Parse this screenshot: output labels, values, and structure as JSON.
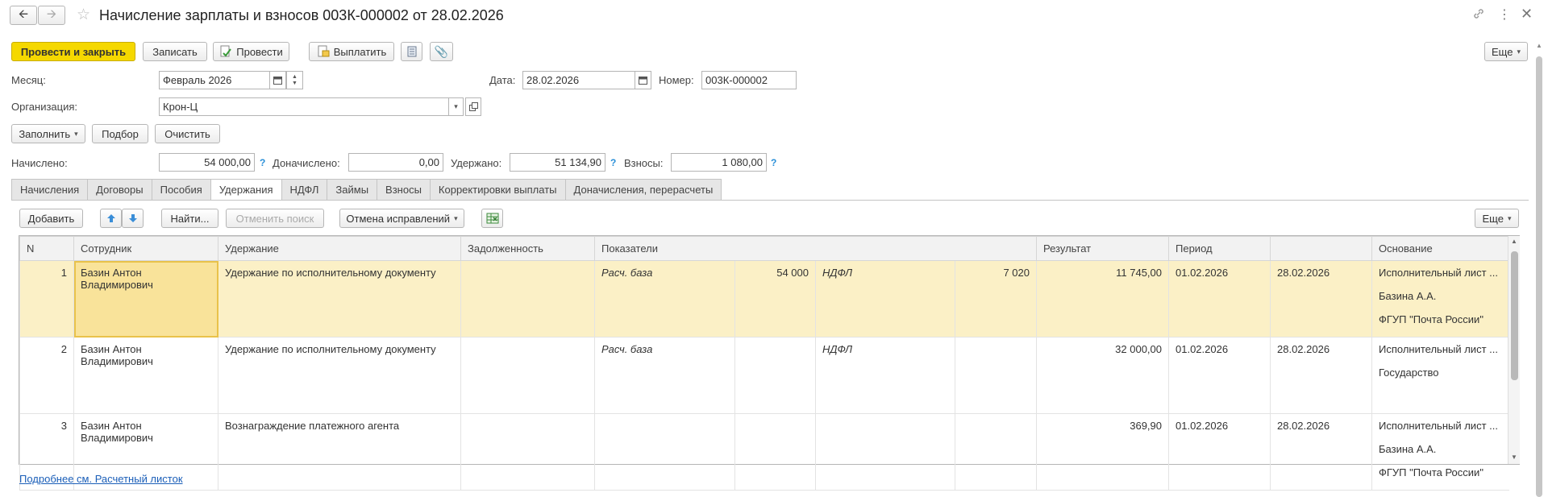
{
  "window": {
    "title": "Начисление зарплаты и взносов 003К-000002 от 28.02.2026"
  },
  "toolbar": {
    "post_close": "Провести и закрыть",
    "save": "Записать",
    "post": "Провести",
    "pay": "Выплатить",
    "more": "Еще"
  },
  "header": {
    "month_label": "Месяц:",
    "month_value": "Февраль 2026",
    "date_label": "Дата:",
    "date_value": "28.02.2026",
    "number_label": "Номер:",
    "number_value": "003К-000002",
    "org_label": "Организация:",
    "org_value": "Крон-Ц"
  },
  "actions": {
    "fill": "Заполнить",
    "select": "Подбор",
    "clear": "Очистить"
  },
  "totals": {
    "accrued_label": "Начислено:",
    "accrued_value": "54 000,00",
    "extra_label": "Доначислено:",
    "extra_value": "0,00",
    "withheld_label": "Удержано:",
    "withheld_value": "51 134,90",
    "contrib_label": "Взносы:",
    "contrib_value": "1 080,00",
    "help": "?"
  },
  "tabs": [
    "Начисления",
    "Договоры",
    "Пособия",
    "Удержания",
    "НДФЛ",
    "Займы",
    "Взносы",
    "Корректировки выплаты",
    "Доначисления, перерасчеты"
  ],
  "active_tab": "Удержания",
  "table_toolbar": {
    "add": "Добавить",
    "find": "Найти...",
    "cancel_search": "Отменить поиск",
    "cancel_fix": "Отмена исправлений",
    "more": "Еще"
  },
  "table": {
    "columns": [
      "N",
      "Сотрудник",
      "Удержание",
      "Задолженность",
      "Показатели",
      "",
      "",
      "",
      "Результат",
      "Период",
      "",
      "Основание"
    ],
    "rows": [
      {
        "n": "1",
        "employee": "Базин Антон Владимирович",
        "deduction": "Удержание по исполнительному документу",
        "debt": "",
        "ind1_name": "Расч. база",
        "ind1_value": "54 000",
        "ind2_name": "НДФЛ",
        "ind2_value": "7 020",
        "result": "11 745,00",
        "period_from": "01.02.2026",
        "period_to": "28.02.2026",
        "basis": [
          "Исполнительный лист ...",
          "Базина А.А.",
          "ФГУП \"Почта России\""
        ]
      },
      {
        "n": "2",
        "employee": "Базин Антон Владимирович",
        "deduction": "Удержание по исполнительному документу",
        "debt": "",
        "ind1_name": "Расч. база",
        "ind1_value": "",
        "ind2_name": "НДФЛ",
        "ind2_value": "",
        "result": "32 000,00",
        "period_from": "01.02.2026",
        "period_to": "28.02.2026",
        "basis": [
          "Исполнительный лист ...",
          "Государство",
          ""
        ]
      },
      {
        "n": "3",
        "employee": "Базин Антон Владимирович",
        "deduction": "Вознаграждение платежного агента",
        "debt": "",
        "ind1_name": "",
        "ind1_value": "",
        "ind2_name": "",
        "ind2_value": "",
        "result": "369,90",
        "period_from": "01.02.2026",
        "period_to": "28.02.2026",
        "basis": [
          "Исполнительный лист ...",
          "Базина А.А.",
          "ФГУП \"Почта России\""
        ]
      }
    ]
  },
  "footer_link": "Подробнее см. Расчетный листок",
  "colors": {
    "primary_button": "#f5d800",
    "selected_row": "#fbf0c6",
    "link": "#1a5eb8",
    "help": "#2a8fd8"
  }
}
